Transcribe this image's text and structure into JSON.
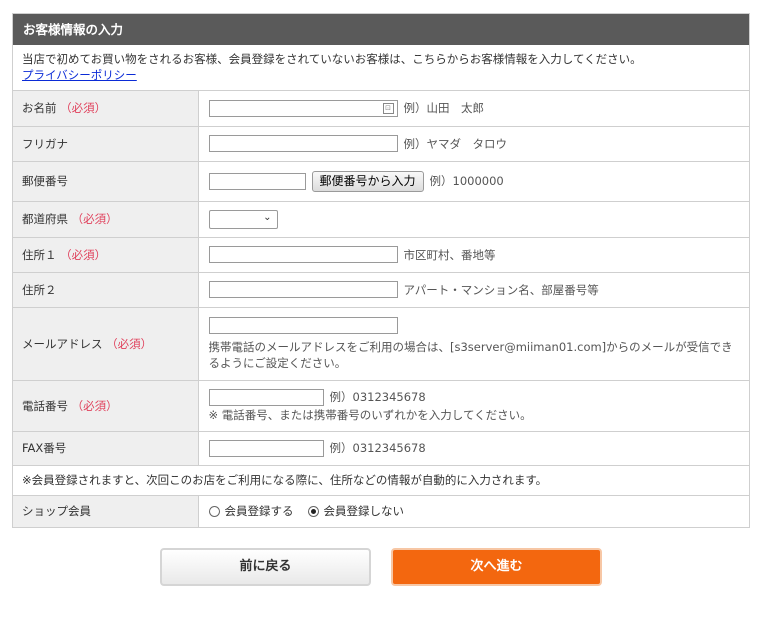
{
  "panel": {
    "title": "お客様情報の入力",
    "intro": "当店で初めてお買い物をされるお客様、会員登録をされていないお客様は、こちらからお客様情報を入力してください。",
    "privacy_link": "プライバシーポリシー"
  },
  "required_mark": "（必須）",
  "rows": {
    "name": {
      "label": "お名前",
      "value": "",
      "hint": "例）山田　太郎"
    },
    "kana": {
      "label": "フリガナ",
      "value": "",
      "hint": "例）ヤマダ　タロウ"
    },
    "zip": {
      "label": "郵便番号",
      "value": "",
      "button": "郵便番号から入力",
      "hint": "例）1000000"
    },
    "pref": {
      "label": "都道府県",
      "selected": ""
    },
    "addr1": {
      "label": "住所１",
      "value": "",
      "hint": "市区町村、番地等"
    },
    "addr2": {
      "label": "住所２",
      "value": "",
      "hint": "アパート・マンション名、部屋番号等"
    },
    "email": {
      "label": "メールアドレス",
      "value": "",
      "note": "携帯電話のメールアドレスをご利用の場合は、[s3server@miiman01.com]からのメールが受信できるようにご設定ください。"
    },
    "tel": {
      "label": "電話番号",
      "value": "",
      "hint": "例）0312345678",
      "note": "※ 電話番号、または携帯番号のいずれかを入力してください。"
    },
    "fax": {
      "label": "FAX番号",
      "value": "",
      "hint": "例）0312345678"
    },
    "member_note": "※会員登録されますと、次回このお店をご利用になる際に、住所などの情報が自動的に入力されます。",
    "shop_member": {
      "label": "ショップ会員",
      "option_yes": "会員登録する",
      "option_no": "会員登録しない",
      "selected": "no"
    }
  },
  "buttons": {
    "back": "前に戻る",
    "next": "次へ進む"
  },
  "colors": {
    "header_bg": "#5a5a5a",
    "required": "#e0415c",
    "next_button": "#f3670f",
    "link": "#0b2bd6"
  }
}
